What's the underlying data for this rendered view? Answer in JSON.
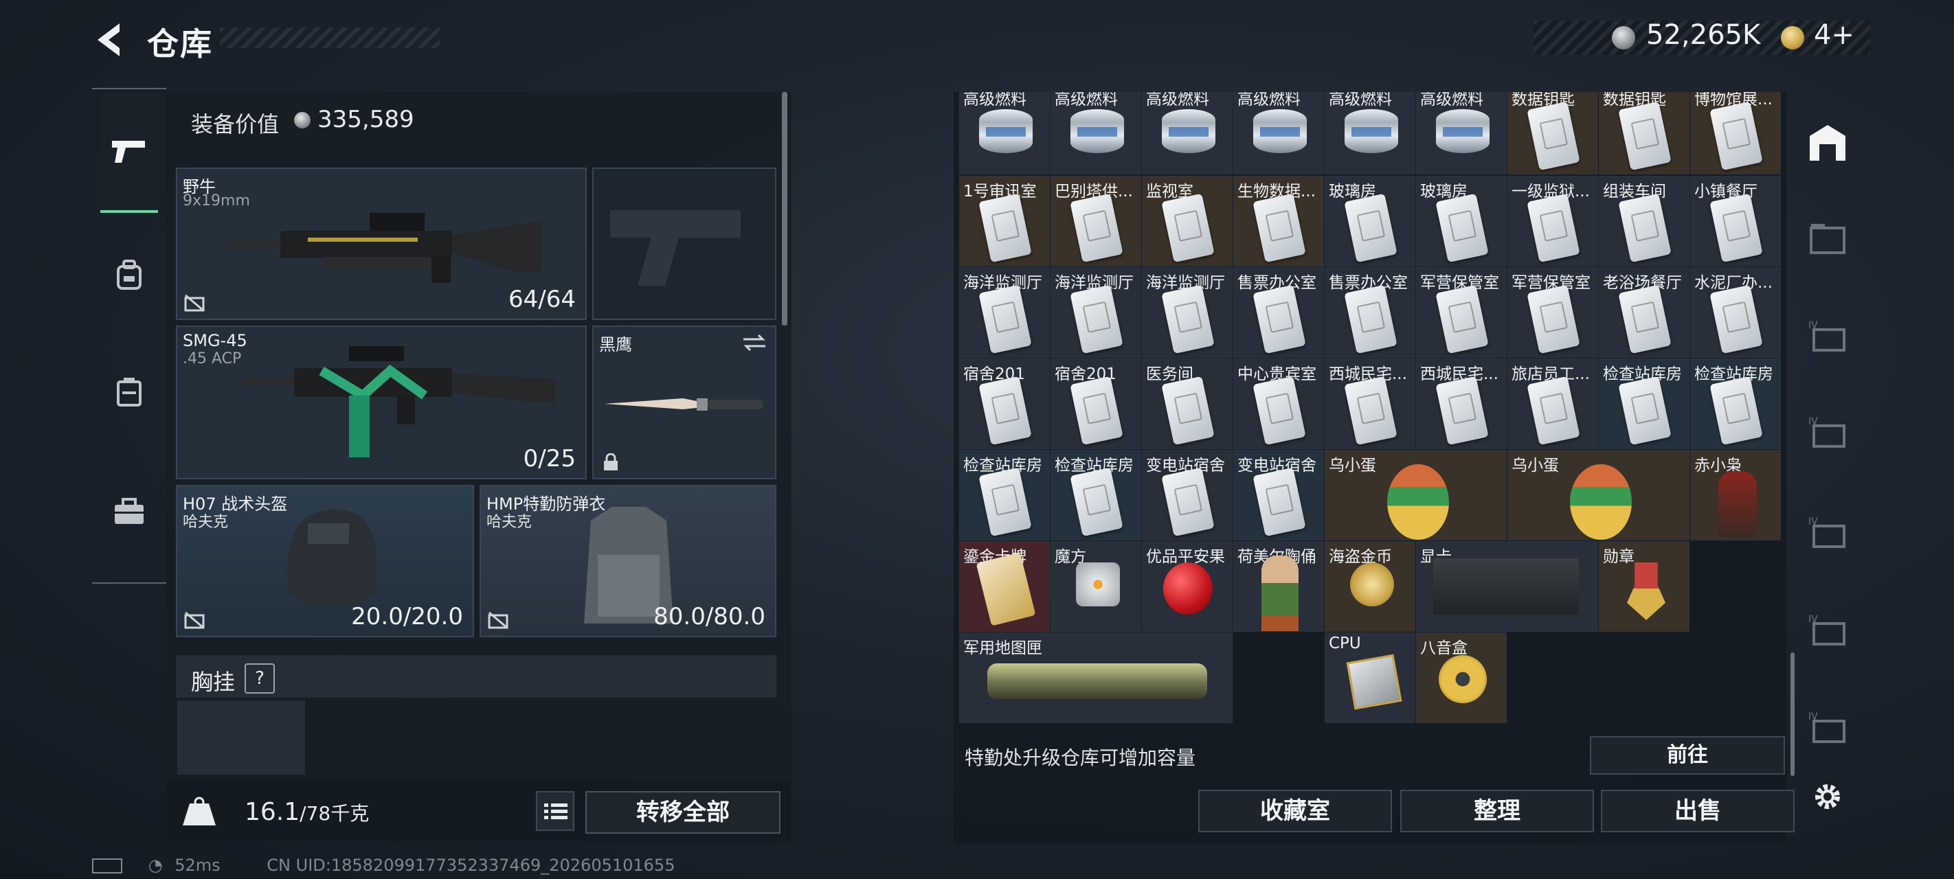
{
  "header": {
    "title": "仓库",
    "money": "52,265K",
    "tickets": "4+"
  },
  "loadout": {
    "equip_value_label": "装备价值",
    "equip_value": "335,589",
    "weapon1": {
      "name": "野牛",
      "ammo": "9x19mm",
      "count": "64/64"
    },
    "weapon2": {
      "name": "SMG-45",
      "ammo": ".45 ACP",
      "count": "0/25"
    },
    "knife": {
      "name": "黑鹰"
    },
    "helmet": {
      "name": "H07 战术头盔",
      "brand": "哈夫克",
      "durability": "20.0/20.0"
    },
    "armor": {
      "name": "HMP特勤防弹衣",
      "brand": "哈夫克",
      "durability": "80.0/80.0"
    },
    "chest_rig_label": "胸挂",
    "chest_rig_help": "?",
    "weight_value": "16.1",
    "weight_max": "/78千克",
    "transfer_all": "转移全部"
  },
  "storage": {
    "row0": [
      "高级燃料",
      "高级燃料",
      "高级燃料",
      "高级燃料",
      "高级燃料",
      "高级燃料",
      "数据钥匙",
      "数据钥匙",
      "博物馆展..."
    ],
    "row1": [
      "1号审讯室",
      "巴别塔供...",
      "监视室",
      "生物数据...",
      "玻璃房",
      "玻璃房",
      "一级监狱...",
      "组装车间",
      "小镇餐厅"
    ],
    "row2": [
      "海洋监测厅",
      "海洋监测厅",
      "海洋监测厅",
      "售票办公室",
      "售票办公室",
      "军营保管室",
      "军营保管室",
      "老浴场餐厅",
      "水泥厂办..."
    ],
    "row3": [
      "宿舍201",
      "宿舍201",
      "医务间",
      "中心贵宾室",
      "西城民宅...",
      "西城民宅...",
      "旅店员工...",
      "检查站库房",
      "检查站库房"
    ],
    "row4": [
      "检查站库房",
      "检查站库房",
      "变电站宿舍",
      "变电站宿舍",
      "乌小蛋",
      "乌小蛋",
      "赤小枭"
    ],
    "row5": [
      "鎏金卡牌",
      "魔方",
      "优品平安果",
      "荷美尔陶俑",
      "海盗金币",
      "显卡",
      "勋章"
    ],
    "row6": [
      "军用地图匣",
      "CPU",
      "八音盒"
    ],
    "note": "特勤处升级仓库可增加容量",
    "goto": "前往",
    "btn_collection": "收藏室",
    "btn_sort": "整理",
    "btn_sell": "出售"
  },
  "status": {
    "ping": "52ms",
    "uid": "CN UID:18582099177352337469_202605101655"
  },
  "colors": {
    "accent_green": "#6fd3a0",
    "brown_cell": "#3a3128",
    "red_cell": "#45252a"
  }
}
